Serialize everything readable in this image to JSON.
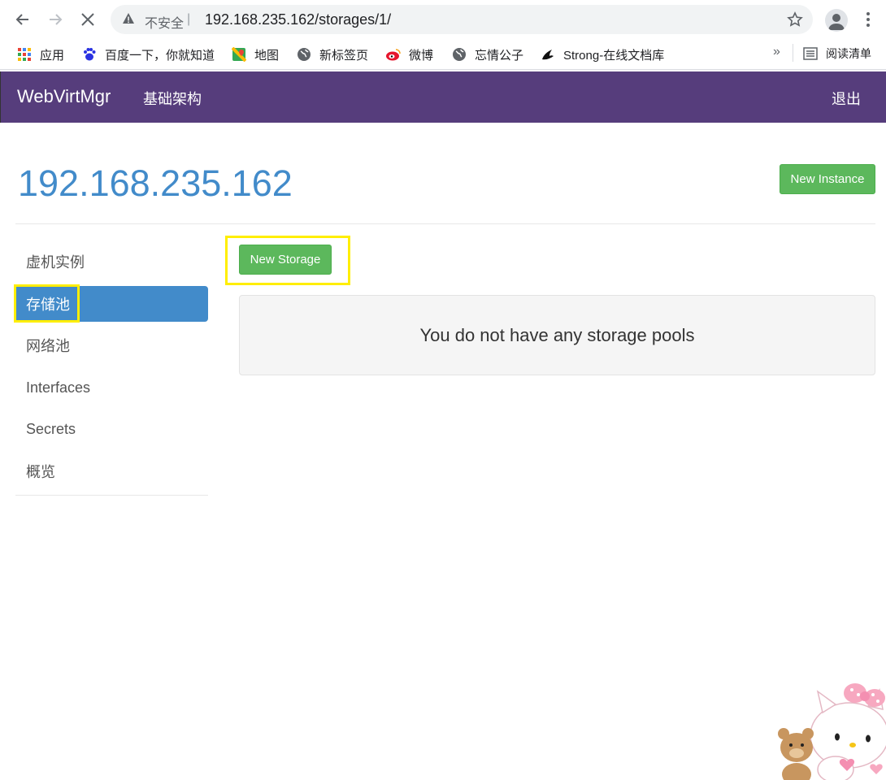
{
  "browser": {
    "insecure_label": "不安全",
    "separator": "|",
    "url": "192.168.235.162/storages/1/",
    "bookmarks": [
      "应用",
      "百度一下，你就知道",
      "地图",
      "新标签页",
      "微博",
      "忘情公子",
      "Strong-在线文档库"
    ],
    "more": "»",
    "reading_list": "阅读清单"
  },
  "navbar": {
    "brand": "WebVirtMgr",
    "infra_link": "基础架构",
    "logout": "退出"
  },
  "page": {
    "title": "192.168.235.162",
    "new_instance_label": "New Instance",
    "new_storage_label": "New Storage",
    "empty_message": "You do not have any storage pools"
  },
  "sidebar": {
    "items": [
      {
        "label": "虚机实例",
        "active": false
      },
      {
        "label": "存储池",
        "active": true
      },
      {
        "label": "网络池",
        "active": false
      },
      {
        "label": "Interfaces",
        "active": false
      },
      {
        "label": "Secrets",
        "active": false
      },
      {
        "label": "概览",
        "active": false
      }
    ]
  },
  "colors": {
    "navbar_bg": "#563d7c",
    "accent_blue": "#428bca",
    "success_green": "#5cb85c",
    "highlight_yellow": "#ffee00"
  }
}
